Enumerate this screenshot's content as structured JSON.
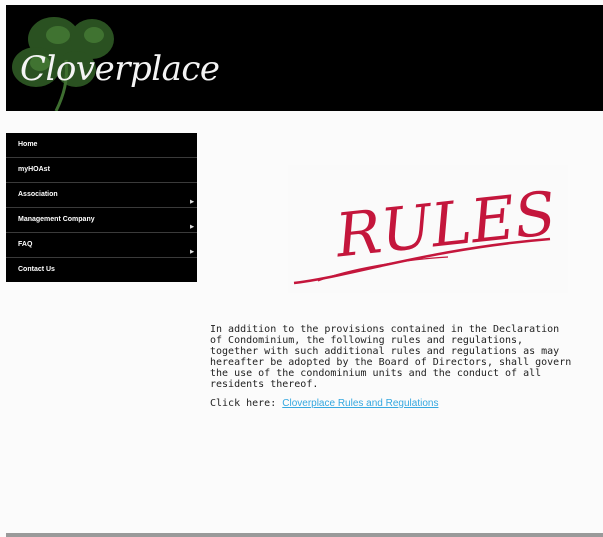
{
  "header": {
    "site_title": "Cloverplace"
  },
  "nav": {
    "items": [
      {
        "label": "Home"
      },
      {
        "label": "myHOAst"
      },
      {
        "label": "Association"
      },
      {
        "label": "Management Company"
      },
      {
        "label": "FAQ"
      },
      {
        "label": "Contact Us"
      }
    ],
    "arrow_glyph": "▶"
  },
  "banner": {
    "text": "RULES"
  },
  "content": {
    "paragraph": "In addition to the provisions contained in the Declaration of Condominium, the following rules and regulations, together with such additional rules and regulations as may hereafter be adopted by the Board of Directors, shall govern the use of the condominium units and the conduct of all residents thereof.",
    "click_prefix": "Click here: ",
    "link_text": "Cloverplace Rules and Regulations"
  },
  "colors": {
    "header_bg": "#000000",
    "nav_bg": "#000000",
    "rules_red": "#c4163c",
    "link_blue": "#35a8e0",
    "leaf_green": "#2f5a25"
  },
  "icons": [
    "clover-logo-icon",
    "submenu-arrow-icon"
  ]
}
